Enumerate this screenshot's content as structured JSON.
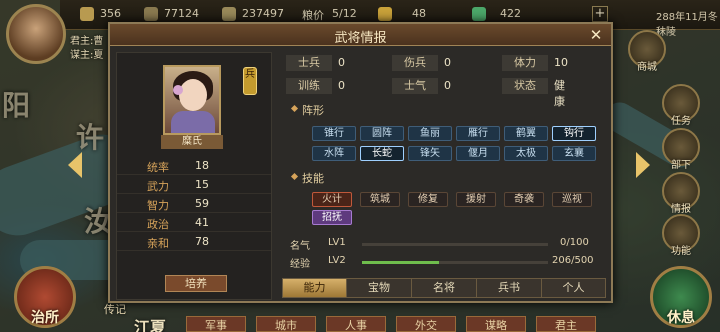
{
  "top_bar": {
    "resources": [
      "356",
      "77124",
      "237497"
    ],
    "grain": {
      "label": "粮价",
      "value": "5/12"
    },
    "tokens": "48",
    "gems": "422",
    "plus": "+",
    "date": "288年11月冬 秣陵"
  },
  "lord": {
    "ruler": "君主:曹",
    "advisor": "谋主:夏"
  },
  "map_labels": [
    "阳",
    "许",
    "汝"
  ],
  "side_buttons": [
    {
      "label": "商城"
    },
    {
      "label": "任务"
    },
    {
      "label": "部下"
    },
    {
      "label": "情报"
    },
    {
      "label": "功能"
    }
  ],
  "big_buttons": {
    "left": "治所",
    "right": "休息"
  },
  "bottom_menu": [
    "军事",
    "城市",
    "人事",
    "外交",
    "谋略",
    "君主"
  ],
  "bottom_label": {
    "bio": "传记",
    "city": "江夏"
  },
  "dialog": {
    "title": "武将情报",
    "close": "✕",
    "general": {
      "name": "糜氏",
      "type_badge": "兵"
    },
    "stats": [
      {
        "label": "统率",
        "value": "18"
      },
      {
        "label": "武力",
        "value": "15"
      },
      {
        "label": "智力",
        "value": "59"
      },
      {
        "label": "政治",
        "value": "41"
      },
      {
        "label": "亲和",
        "value": "78"
      }
    ],
    "cultivate": "培养",
    "info": [
      {
        "label": "士兵",
        "value": "0"
      },
      {
        "label": "伤兵",
        "value": "0"
      },
      {
        "label": "体力",
        "value": "10"
      },
      {
        "label": "训练",
        "value": "0"
      },
      {
        "label": "士气",
        "value": "0"
      },
      {
        "label": "状态",
        "value": "健康"
      }
    ],
    "formation_title": "阵形",
    "formations": [
      {
        "label": "锥行",
        "active": false
      },
      {
        "label": "圆阵",
        "active": false
      },
      {
        "label": "鱼丽",
        "active": false
      },
      {
        "label": "雁行",
        "active": false
      },
      {
        "label": "鹤翼",
        "active": false
      },
      {
        "label": "钩行",
        "active": true
      },
      {
        "label": "水阵",
        "active": false
      },
      {
        "label": "长蛇",
        "active": true
      },
      {
        "label": "锋矢",
        "active": false
      },
      {
        "label": "偃月",
        "active": false
      },
      {
        "label": "太极",
        "active": false
      },
      {
        "label": "玄襄",
        "active": false
      }
    ],
    "skill_title": "技能",
    "skills": [
      {
        "label": "火计",
        "style": "red"
      },
      {
        "label": "筑城",
        "style": "normal"
      },
      {
        "label": "修复",
        "style": "normal"
      },
      {
        "label": "援射",
        "style": "normal"
      },
      {
        "label": "奇袭",
        "style": "normal"
      },
      {
        "label": "巡视",
        "style": "normal"
      },
      {
        "label": "招抚",
        "style": "purple"
      }
    ],
    "progress": [
      {
        "label": "名气",
        "level": "LV1",
        "value": "0/100",
        "ratio": 0.0
      },
      {
        "label": "经验",
        "level": "LV2",
        "value": "206/500",
        "ratio": 0.412
      }
    ],
    "tabs": [
      {
        "label": "能力",
        "active": true
      },
      {
        "label": "宝物",
        "active": false
      },
      {
        "label": "名将",
        "active": false
      },
      {
        "label": "兵书",
        "active": false
      },
      {
        "label": "个人",
        "active": false
      }
    ]
  },
  "colors": {
    "accent": "#d6a35a",
    "progress": "#6fbd4d",
    "formation_active": "#9fd0ff"
  }
}
